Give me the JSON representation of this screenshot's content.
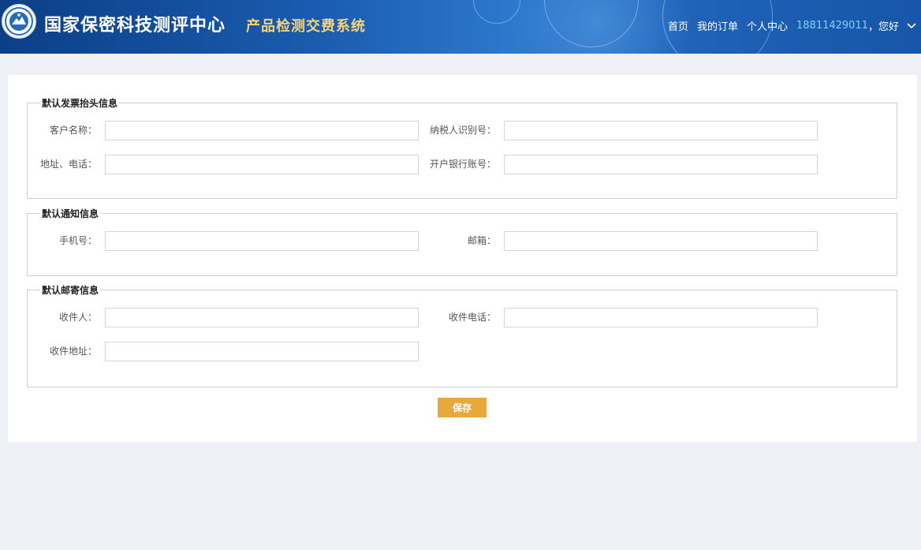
{
  "header": {
    "org_title": "国家保密科技测评中心",
    "system_title": "产品检测交费系统",
    "nav": {
      "home": "首页",
      "my_orders": "我的订单",
      "personal_center": "个人中心",
      "user_phone": "18811429011",
      "greeting": "，您好"
    }
  },
  "sections": {
    "invoice": {
      "legend": "默认发票抬头信息",
      "customer_name_label": "客户名称：",
      "customer_name_value": "",
      "taxpayer_id_label": "纳税人识别号：",
      "taxpayer_id_value": "",
      "address_phone_label": "地址、电话：",
      "address_phone_value": "",
      "bank_account_label": "开户银行账号：",
      "bank_account_value": ""
    },
    "notify": {
      "legend": "默认通知信息",
      "mobile_label": "手机号：",
      "mobile_value": "",
      "email_label": "邮箱：",
      "email_value": ""
    },
    "mailing": {
      "legend": "默认邮寄信息",
      "recipient_label": "收件人：",
      "recipient_value": "",
      "recipient_phone_label": "收件电话：",
      "recipient_phone_value": "",
      "recipient_address_label": "收件地址：",
      "recipient_address_value": ""
    }
  },
  "actions": {
    "save_label": "保存"
  },
  "colors": {
    "header_blue": "#1a5cb0",
    "system_title_gold": "#f5d477",
    "user_phone_cyan": "#7fd0ff",
    "save_button_orange": "#e8a83a",
    "page_bg": "#eef0f5"
  }
}
